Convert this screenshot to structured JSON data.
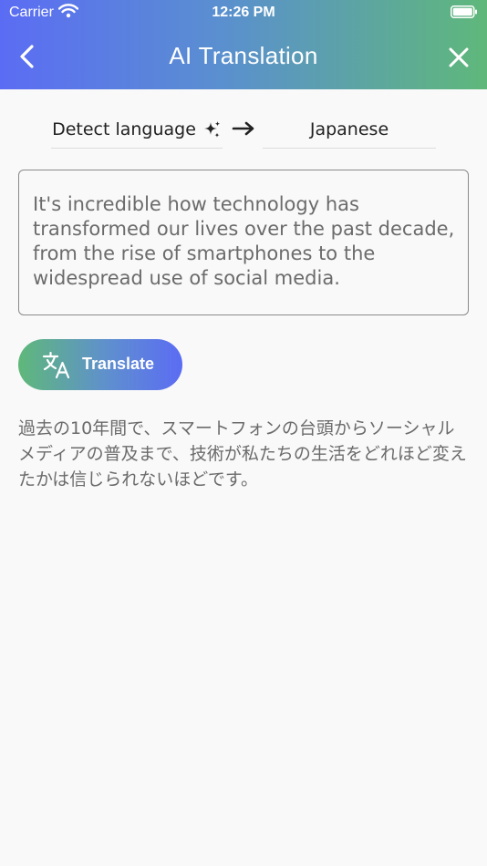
{
  "status_bar": {
    "carrier": "Carrier",
    "time": "12:26 PM"
  },
  "header": {
    "title": "AI Translation",
    "back_icon": "chevron-left-icon",
    "close_icon": "close-icon"
  },
  "languages": {
    "source": "Detect language",
    "source_icon": "sparkle-icon",
    "arrow_icon": "arrow-right-icon",
    "target": "Japanese"
  },
  "input": {
    "text": "It's incredible how technology has transformed our lives over the past decade, from the rise of smartphones to the widespread use of social media."
  },
  "translate_button": {
    "label": "Translate",
    "icon": "translate-icon"
  },
  "output": {
    "text": "過去の10年間で、スマートフォンの台頭からソーシャルメディアの普及まで、技術が私たちの生活をどれほど変えたかは信じられないほどです。"
  },
  "colors": {
    "header_gradient_start": "#5b6cf4",
    "header_gradient_end": "#5fb87a",
    "background": "#f9f9f9"
  }
}
